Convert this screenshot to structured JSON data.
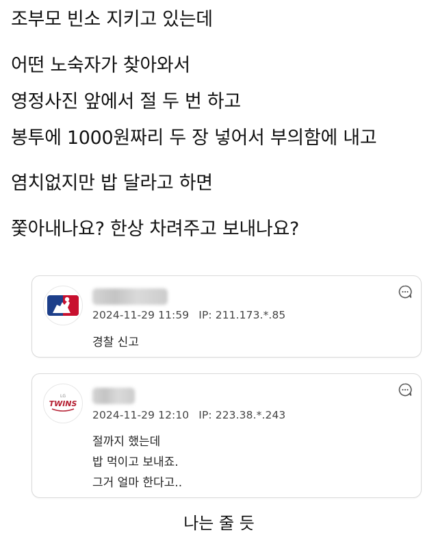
{
  "post": {
    "lines": [
      "조부모 빈소 지키고 있는데",
      "어떤 노숙자가 찾아와서",
      "영정사진 앞에서 절 두 번 하고",
      "봉투에 1000원짜리 두 장 넣어서 부의함에 내고",
      "염치없지만 밥 달라고 하면",
      "쫓아내나요? 한상 차려주고 보내나요?"
    ]
  },
  "comments": [
    {
      "avatar_icon": "mlb-logo-icon",
      "date": "2024-11-29 11:59",
      "ip": "IP: 211.173.*.85",
      "body": [
        "경찰 신고"
      ]
    },
    {
      "avatar_icon": "lg-twins-logo-icon",
      "avatar_text_small": "LG",
      "avatar_text": "TWINS",
      "date": "2024-11-29 12:10",
      "ip": "IP: 223.38.*.243",
      "body": [
        "절까지 했는데",
        "밥 먹이고 보내죠.",
        "그거 얼마 한다고.."
      ]
    }
  ],
  "caption": "나는 줄 듯",
  "colors": {
    "mlb_blue": "#1d3f8a",
    "mlb_red": "#c8102e",
    "twins_red": "#b51f32",
    "card_border": "#d9d9d9"
  }
}
